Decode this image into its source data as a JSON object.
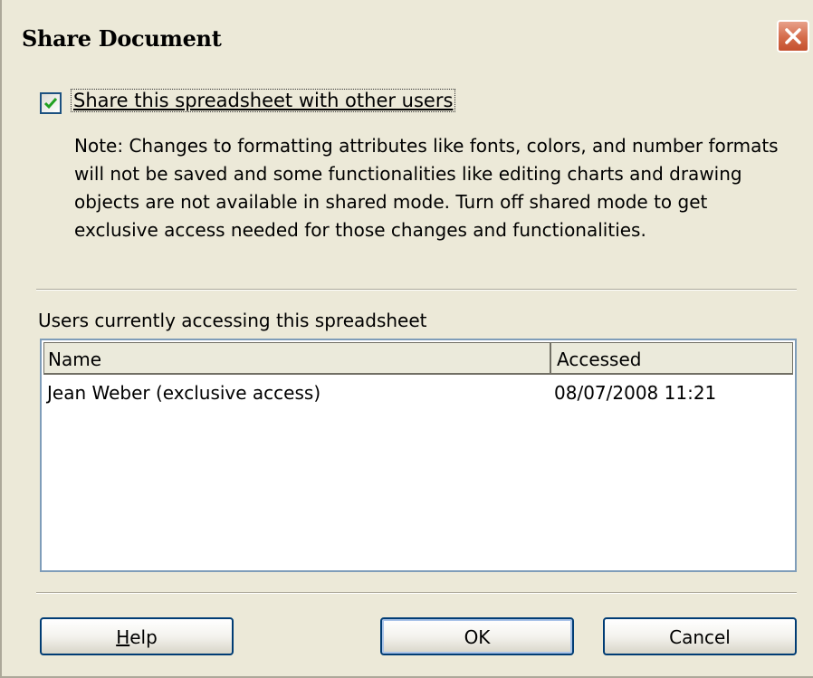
{
  "window": {
    "title": "Share Document"
  },
  "share": {
    "checked": true,
    "label": "Share this spreadsheet with other users",
    "note": "Note: Changes to formatting attributes like fonts, colors, and number formats will not be saved and some functionalities like editing charts and drawing objects are not available in shared mode. Turn off shared mode to get exclusive access needed for those changes and functionalities."
  },
  "users": {
    "label": "Users currently accessing this spreadsheet",
    "columns": [
      "Name",
      "Accessed"
    ],
    "rows": [
      {
        "name": "Jean Weber (exclusive access)",
        "accessed": "08/07/2008 11:21"
      }
    ]
  },
  "buttons": {
    "help": "Help",
    "ok": "OK",
    "cancel": "Cancel"
  },
  "colors": {
    "dialog_bg": "#ece9d8",
    "close_button": "#d46b4a",
    "list_border": "#7f9db9",
    "button_border": "#003c74"
  }
}
